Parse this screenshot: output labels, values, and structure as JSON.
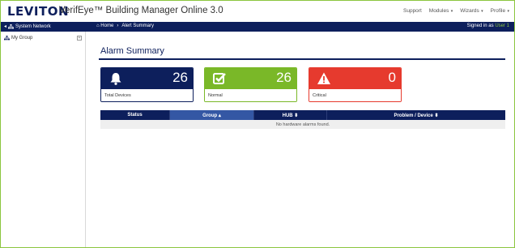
{
  "header": {
    "logo_text": "LEVITON",
    "app_title": "VerifEye™ Building Manager Online 3.0",
    "nav": {
      "support": "Support",
      "modules": "Modules",
      "wizards": "Wizards",
      "profile": "Profile"
    }
  },
  "navbar": {
    "system_network": "System Network",
    "breadcrumb": {
      "home": "Home",
      "separator": "›",
      "current": "Alert Summary"
    },
    "signed_in_prefix": "Signed in as",
    "user": "User 1"
  },
  "sidebar": {
    "items": [
      {
        "label": "My Group",
        "expand_icon": "plus-box-icon"
      }
    ]
  },
  "main": {
    "title": "Alarm Summary",
    "cards": [
      {
        "label": "Total Devices",
        "count": "26",
        "icon": "bell-icon",
        "color": "#0d1f5c"
      },
      {
        "label": "Normal",
        "count": "26",
        "icon": "checkbox-icon",
        "color": "#7ab828"
      },
      {
        "label": "Critical",
        "count": "0",
        "icon": "warning-icon",
        "color": "#e63a2e"
      }
    ],
    "table": {
      "columns": [
        {
          "label": "Status"
        },
        {
          "label": "Group ▴"
        },
        {
          "label": "HUB ⬍"
        },
        {
          "label": "Problem / Device ⬍"
        }
      ],
      "empty_message": "No hardware alarms found."
    }
  },
  "colors": {
    "brand_navy": "#0d1f5c",
    "brand_green": "#7ab828",
    "critical_red": "#e63a2e"
  }
}
